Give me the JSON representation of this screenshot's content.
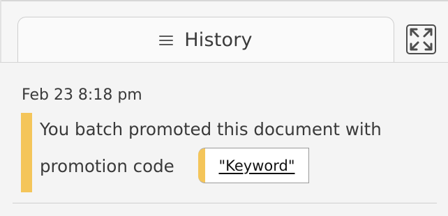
{
  "panel": {
    "tab_label": "History",
    "tab_icon": "hamburger-icon",
    "expand_icon": "expand-icon"
  },
  "entry": {
    "timestamp": "Feb 23 8:18 pm",
    "message_line1": "You batch promoted this document with",
    "message_line2": "promotion code",
    "code": "\"Keyword\"",
    "accent_color": "#f4c55a"
  }
}
